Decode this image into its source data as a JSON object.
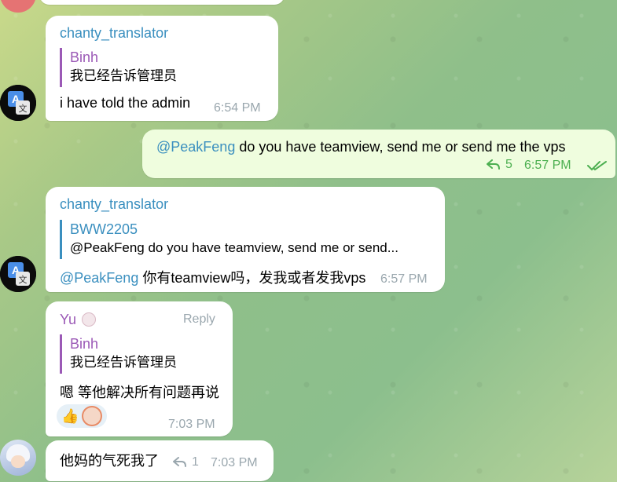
{
  "messages": {
    "m1": {
      "sender": "chanty_translator",
      "quote_name": "Binh",
      "quote_text": "我已经告诉管理员",
      "text": "i have told the admin",
      "time": "6:54 PM"
    },
    "m2": {
      "mention": "@PeakFeng",
      "text": " do you have teamview, send me or send me the vps",
      "reply_count": "5",
      "time": "6:57 PM"
    },
    "m3": {
      "sender": "chanty_translator",
      "quote_name": "BWW2205",
      "quote_text": "@PeakFeng do you have teamview, send me or send...",
      "mention": "@PeakFeng",
      "text": " 你有teamview吗，发我或者发我vps",
      "time": "6:57 PM"
    },
    "m4": {
      "sender": "Yu",
      "reply_label": "Reply",
      "quote_name": "Binh",
      "quote_text": "我已经告诉管理员",
      "text": "嗯 等他解决所有问题再说",
      "reaction_emoji": "👍",
      "time": "7:03 PM"
    },
    "m5": {
      "text": "他妈的气死我了",
      "reply_count": "1",
      "time": "7:03 PM"
    }
  },
  "colors": {
    "translator_name": "#3a8fbf",
    "quote_purple": "#9b59b6",
    "quote_blue": "#3a8fbf",
    "yu_name": "#9b59b6",
    "outgoing_meta": "#4caf50"
  },
  "icons": [
    "translate-avatar-icon",
    "reply-arrow-icon",
    "double-check-icon",
    "thumbs-up-icon"
  ]
}
